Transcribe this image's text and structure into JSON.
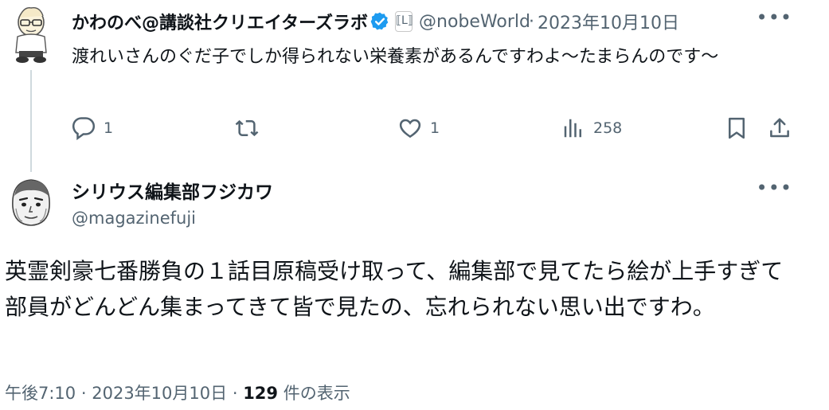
{
  "parent_tweet": {
    "author_name": "かわのべ@講談社クリエイターズラボ",
    "author_handle": "@nobeWorld",
    "separator": "·",
    "date": "2023年10月10日",
    "text": "渡れいさんのぐだ子でしか得られない栄養素があるんですわよ〜たまらんのです〜",
    "affiliate_badge": "⟦L⟧",
    "stats": {
      "replies": "1",
      "likes": "1",
      "views": "258"
    },
    "icons": [
      "reply-icon",
      "retweet-icon",
      "like-icon",
      "views-icon",
      "bookmark-icon",
      "share-icon"
    ]
  },
  "main_tweet": {
    "author_name": "シリウス編集部フジカワ",
    "author_handle": "@magazinefuji",
    "text": "英霊剣豪七番勝負の１話目原稿受け取って、編集部で見てたら絵が上手すぎて部員がどんどん集まってきて皆で見たの、忘れられない思い出ですわ。",
    "time": "午後7:10",
    "dot": "·",
    "date": "2023年10月10日",
    "views_count": "129",
    "views_label": "件の表示"
  },
  "more_glyph": "•••",
  "colors": {
    "text": "#0f1419",
    "secondary": "#536471",
    "verified": "#1d9bf0",
    "thread_line": "#cfd9de"
  }
}
